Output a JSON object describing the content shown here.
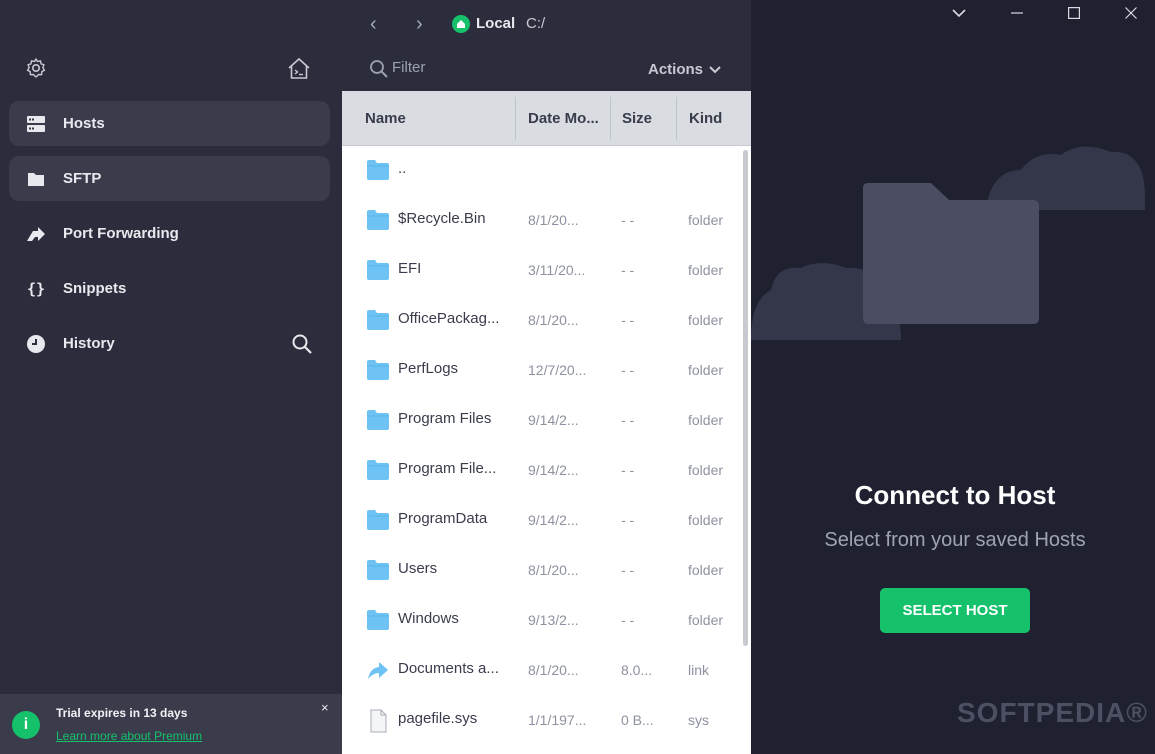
{
  "sidebar": {
    "settings_icon": "gear-icon",
    "home_icon": "home-terminal-icon",
    "items": [
      {
        "label": "Hosts",
        "icon": "server-icon",
        "active": true
      },
      {
        "label": "SFTP",
        "icon": "folder-icon",
        "active": true
      },
      {
        "label": "Port Forwarding",
        "icon": "port-forward-icon",
        "active": false
      },
      {
        "label": "Snippets",
        "icon": "braces-icon",
        "active": false
      },
      {
        "label": "History",
        "icon": "clock-icon",
        "active": false
      }
    ],
    "history_search_icon": "search-icon",
    "trial": {
      "title": "Trial expires in 13 days",
      "link": "Learn more about Premium",
      "close": "×"
    }
  },
  "files": {
    "location_label": "Local",
    "path": "C:/",
    "filter_placeholder": "Filter",
    "actions_label": "Actions",
    "columns": {
      "name": "Name",
      "date": "Date Mo...",
      "size": "Size",
      "kind": "Kind"
    },
    "rows": [
      {
        "name": "..",
        "date": "",
        "size": "",
        "kind": "",
        "icon": "folder"
      },
      {
        "name": "$Recycle.Bin",
        "date": "8/1/20...",
        "size": "- -",
        "kind": "folder",
        "icon": "folder"
      },
      {
        "name": "EFI",
        "date": "3/11/20...",
        "size": "- -",
        "kind": "folder",
        "icon": "folder"
      },
      {
        "name": "OfficePackag...",
        "date": "8/1/20...",
        "size": "- -",
        "kind": "folder",
        "icon": "folder"
      },
      {
        "name": "PerfLogs",
        "date": "12/7/20...",
        "size": "- -",
        "kind": "folder",
        "icon": "folder"
      },
      {
        "name": "Program Files",
        "date": "9/14/2...",
        "size": "- -",
        "kind": "folder",
        "icon": "folder"
      },
      {
        "name": "Program File...",
        "date": "9/14/2...",
        "size": "- -",
        "kind": "folder",
        "icon": "folder"
      },
      {
        "name": "ProgramData",
        "date": "9/14/2...",
        "size": "- -",
        "kind": "folder",
        "icon": "folder"
      },
      {
        "name": "Users",
        "date": "8/1/20...",
        "size": "- -",
        "kind": "folder",
        "icon": "folder"
      },
      {
        "name": "Windows",
        "date": "9/13/2...",
        "size": "- -",
        "kind": "folder",
        "icon": "folder"
      },
      {
        "name": "Documents a...",
        "date": "8/1/20...",
        "size": "8.0...",
        "kind": "link",
        "icon": "link"
      },
      {
        "name": "pagefile.sys",
        "date": "1/1/197...",
        "size": "0 B...",
        "kind": "sys",
        "icon": "file"
      }
    ]
  },
  "connect": {
    "title": "Connect to Host",
    "subtitle": "Select from your saved Hosts",
    "button": "SELECT HOST"
  },
  "window": {
    "minimize": "chevron-down-icon",
    "restore": "minimize-icon",
    "maximize": "maximize-icon",
    "close": "close-icon"
  },
  "watermark": "SOFTPEDIA®",
  "colors": {
    "accent": "#15c26b",
    "sidebar": "#2b2d3c",
    "background": "#1f2130",
    "folder": "#6ec3f4"
  }
}
